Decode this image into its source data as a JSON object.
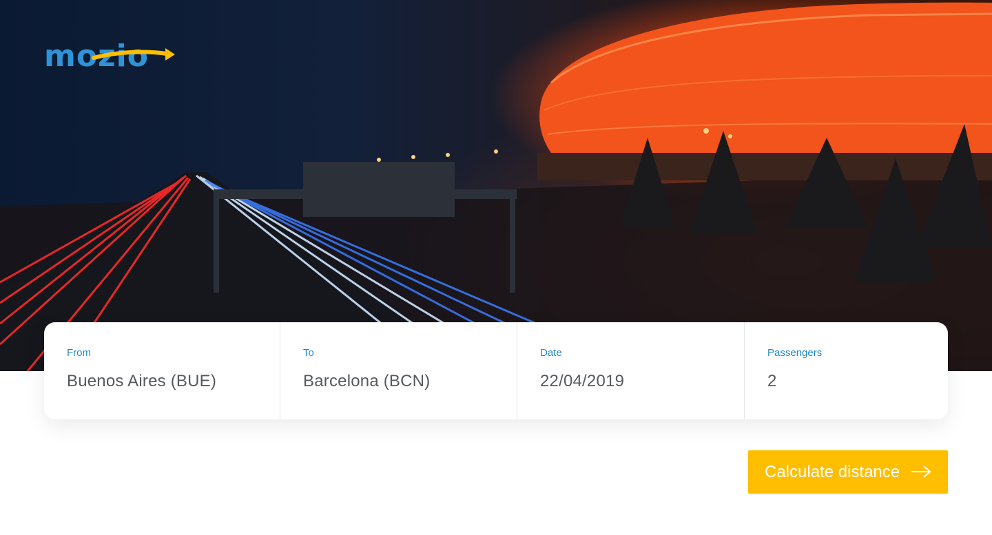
{
  "brand": {
    "logo_text": "mozio",
    "primary_color": "#2f93d8",
    "accent_color": "#ffbf00"
  },
  "hero": {
    "image": "night highway with light trails and illuminated stadium"
  },
  "search": {
    "from": {
      "label": "From",
      "value": "Buenos Aires (BUE)"
    },
    "to": {
      "label": "To",
      "value": "Barcelona (BCN)"
    },
    "date": {
      "label": "Date",
      "value": "22/04/2019"
    },
    "passengers": {
      "label": "Passengers",
      "value": "2"
    }
  },
  "action": {
    "label": "Calculate distance",
    "icon": "arrow-right-icon"
  }
}
